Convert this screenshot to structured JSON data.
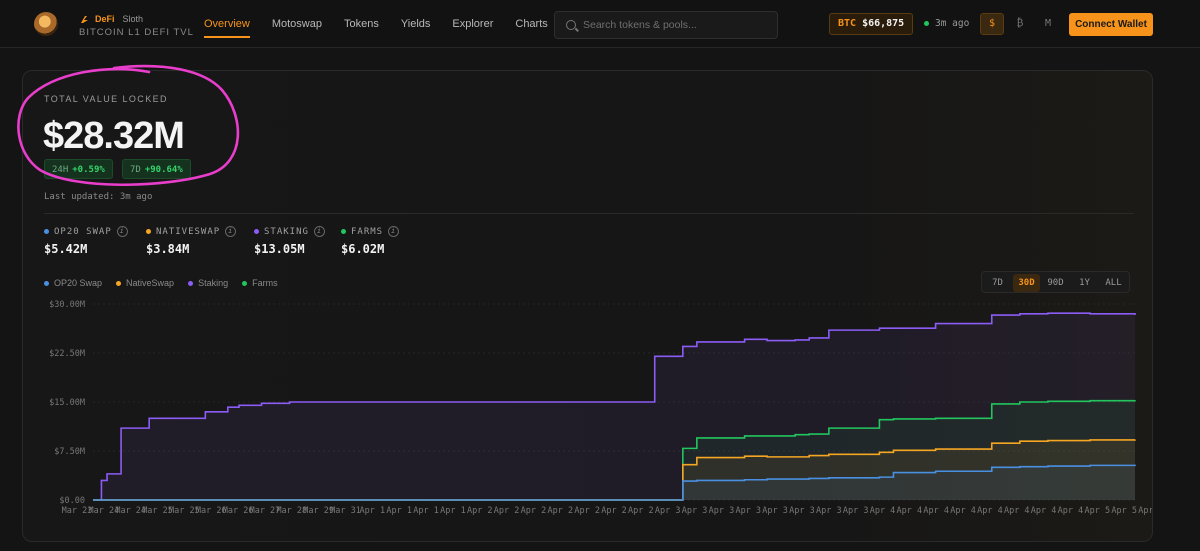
{
  "brand": {
    "tag": "DeFi",
    "name": "Sloth",
    "subtitle": "BITCOIN L1 DEFI TVL"
  },
  "nav": [
    {
      "label": "Overview",
      "active": true
    },
    {
      "label": "Motoswap",
      "active": false
    },
    {
      "label": "Tokens",
      "active": false
    },
    {
      "label": "Yields",
      "active": false
    },
    {
      "label": "Explorer",
      "active": false
    },
    {
      "label": "Charts",
      "active": false
    }
  ],
  "search": {
    "placeholder": "Search tokens & pools..."
  },
  "btc": {
    "label": "BTC",
    "price": "$66,875"
  },
  "status": {
    "text": "3m ago"
  },
  "currency": [
    {
      "label": "$",
      "active": true
    },
    {
      "label": "₿",
      "active": false
    },
    {
      "label": "M",
      "active": false
    }
  ],
  "connect_label": "Connect Wallet",
  "tvl": {
    "label": "TOTAL VALUE LOCKED",
    "value": "$28.32M",
    "change_24h": {
      "period": "24H",
      "value": "+0.59%"
    },
    "change_7d": {
      "period": "7D",
      "value": "+90.64%"
    },
    "updated": "Last updated: 3m ago"
  },
  "breakdown": [
    {
      "label": "OP20 SWAP",
      "value": "$5.42M",
      "color": "#4a90e2"
    },
    {
      "label": "NATIVESWAP",
      "value": "$3.84M",
      "color": "#f5a623"
    },
    {
      "label": "STAKING",
      "value": "$13.05M",
      "color": "#8b5cf6"
    },
    {
      "label": "FARMS",
      "value": "$6.02M",
      "color": "#22c55e"
    }
  ],
  "ranges": [
    {
      "label": "7D",
      "active": false
    },
    {
      "label": "30D",
      "active": true
    },
    {
      "label": "90D",
      "active": false
    },
    {
      "label": "1Y",
      "active": false
    },
    {
      "label": "ALL",
      "active": false
    }
  ],
  "chart_data": {
    "type": "area",
    "ylim": [
      0,
      30
    ],
    "ytick_labels": [
      "$0.00",
      "$7.50M",
      "$15.00M",
      "$22.50M",
      "$30.00M"
    ],
    "ytick_values": [
      0,
      7.5,
      15,
      22.5,
      30
    ],
    "xtick_labels": [
      "Mar 23",
      "Mar 24",
      "Mar 24",
      "Mar 25",
      "Mar 25",
      "Mar 26",
      "Mar 26",
      "Mar 27",
      "Mar 28",
      "Mar 29",
      "Mar 31",
      "Apr 1",
      "Apr 1",
      "Apr 1",
      "Apr 1",
      "Apr 2",
      "Apr 2",
      "Apr 2",
      "Apr 2",
      "Apr 2",
      "Apr 2",
      "Apr 2",
      "Apr 3",
      "Apr 3",
      "Apr 3",
      "Apr 3",
      "Apr 3",
      "Apr 3",
      "Apr 3",
      "Apr 3",
      "Apr 4",
      "Apr 4",
      "Apr 4",
      "Apr 4",
      "Apr 4",
      "Apr 4",
      "Apr 4",
      "Apr 4",
      "Apr 5",
      "Apr 5",
      "Apr 5"
    ],
    "x_index": [
      0,
      3,
      5,
      10,
      20,
      40,
      48,
      52,
      60,
      70,
      75,
      80,
      82,
      85,
      100,
      110,
      118,
      125,
      138,
      150,
      160,
      170,
      185,
      195,
      200,
      210,
      215,
      232,
      240,
      250,
      255,
      262,
      280,
      285,
      300,
      320,
      330,
      340,
      355,
      371
    ],
    "series": [
      {
        "name": "OP20 Swap",
        "color": "#4a90e2",
        "values": [
          0,
          0,
          0,
          0,
          0,
          0,
          0,
          0,
          0,
          0,
          0,
          0,
          0,
          0,
          0,
          0,
          0,
          0,
          0,
          0,
          0,
          0,
          0,
          0,
          0,
          2.9,
          3.0,
          3.1,
          3.2,
          3.2,
          3.3,
          3.4,
          3.5,
          4.2,
          4.4,
          5.0,
          5.1,
          5.2,
          5.3,
          5.42
        ]
      },
      {
        "name": "NativeSwap",
        "color": "#f5a623",
        "values": [
          0,
          0,
          0,
          0,
          0,
          0,
          0,
          0,
          0,
          0,
          0,
          0,
          0,
          0,
          0,
          0,
          0,
          0,
          0,
          0,
          0,
          0,
          0,
          0,
          0,
          5.4,
          6.5,
          6.7,
          6.6,
          6.6,
          6.8,
          7.0,
          7.3,
          7.6,
          7.8,
          8.7,
          9.0,
          9.1,
          9.2,
          9.26
        ]
      },
      {
        "name": "Staking",
        "color": "#8b5cf6",
        "values": [
          0,
          3,
          4,
          11,
          12.5,
          13.5,
          14.2,
          14.5,
          14.8,
          15.0,
          15.0,
          15.0,
          15.0,
          15.0,
          15.0,
          15.0,
          15.0,
          15.0,
          15.0,
          15.0,
          15.0,
          15.0,
          15.0,
          15.0,
          22.0,
          23.5,
          24.2,
          24.6,
          24.4,
          24.5,
          24.8,
          26.0,
          26.3,
          26.3,
          27.0,
          28.3,
          28.5,
          28.6,
          28.5,
          28.32
        ]
      },
      {
        "name": "Farms",
        "color": "#22c55e",
        "values": [
          0,
          0,
          0,
          0,
          0,
          0,
          0,
          0,
          0,
          0,
          0,
          0,
          0,
          0,
          0,
          0,
          0,
          0,
          0,
          0,
          0,
          0,
          0,
          0,
          0,
          7.9,
          9.5,
          9.8,
          9.8,
          10.0,
          10.1,
          11.0,
          12.3,
          12.4,
          12.5,
          14.7,
          15.0,
          15.1,
          15.2,
          15.28
        ]
      }
    ]
  }
}
